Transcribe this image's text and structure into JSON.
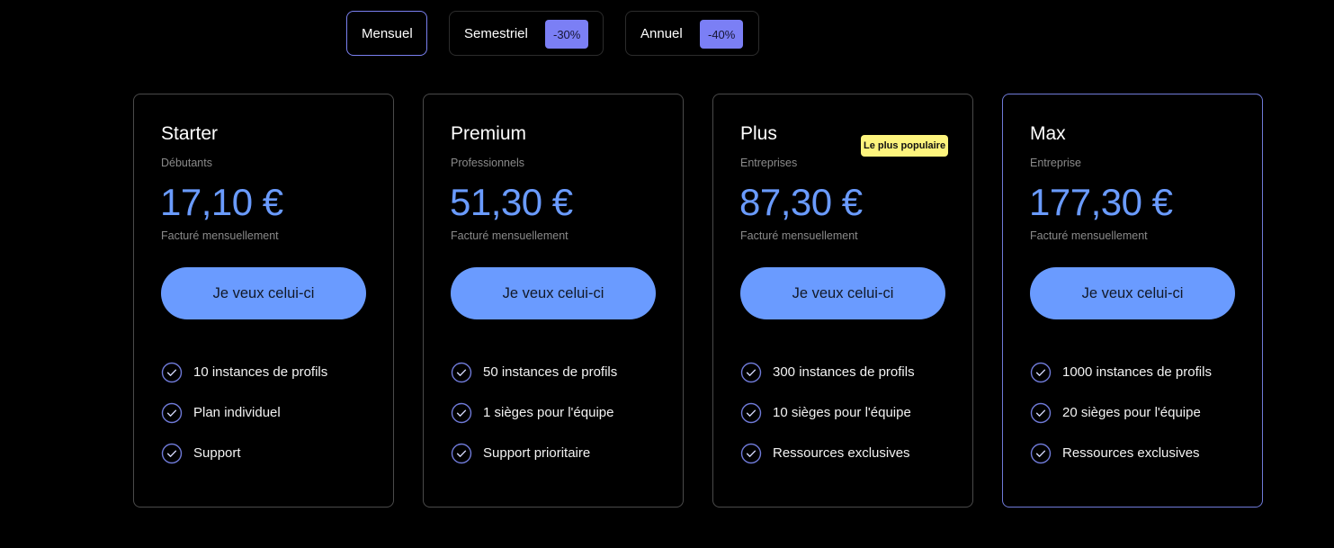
{
  "billing": {
    "options": [
      {
        "label": "Mensuel",
        "discount": null,
        "active": true
      },
      {
        "label": "Semestriel",
        "discount": "-30%",
        "active": false
      },
      {
        "label": "Annuel",
        "discount": "-40%",
        "active": false
      }
    ]
  },
  "colors": {
    "accent": "#6a9bff",
    "discount_badge": "#7b7ff5",
    "popular_badge": "#fdf47d",
    "background": "#000000"
  },
  "plans": [
    {
      "name": "Starter",
      "audience": "Débutants",
      "price": "17,10 €",
      "billing_note": "Facturé mensuellement",
      "cta": "Je veux celui-ci",
      "features": [
        "10 instances de profils",
        "Plan individuel",
        "Support"
      ]
    },
    {
      "name": "Premium",
      "audience": "Professionnels",
      "price": "51,30 €",
      "billing_note": "Facturé mensuellement",
      "cta": "Je veux celui-ci",
      "features": [
        "50 instances de profils",
        "1 sièges pour l'équipe",
        "Support prioritaire"
      ]
    },
    {
      "name": "Plus",
      "audience": "Entreprises",
      "price": "87,30 €",
      "billing_note": "Facturé mensuellement",
      "cta": "Je veux celui-ci",
      "badge": "Le plus populaire",
      "features": [
        "300 instances de profils",
        "10 sièges pour l'équipe",
        "Ressources exclusives"
      ]
    },
    {
      "name": "Max",
      "audience": "Entreprise",
      "price": "177,30 €",
      "billing_note": "Facturé mensuellement",
      "cta": "Je veux celui-ci",
      "features": [
        "1000 instances de profils",
        "20 sièges pour l'équipe",
        "Ressources exclusives"
      ]
    }
  ],
  "icons": {
    "feature": "check-circle-icon"
  }
}
